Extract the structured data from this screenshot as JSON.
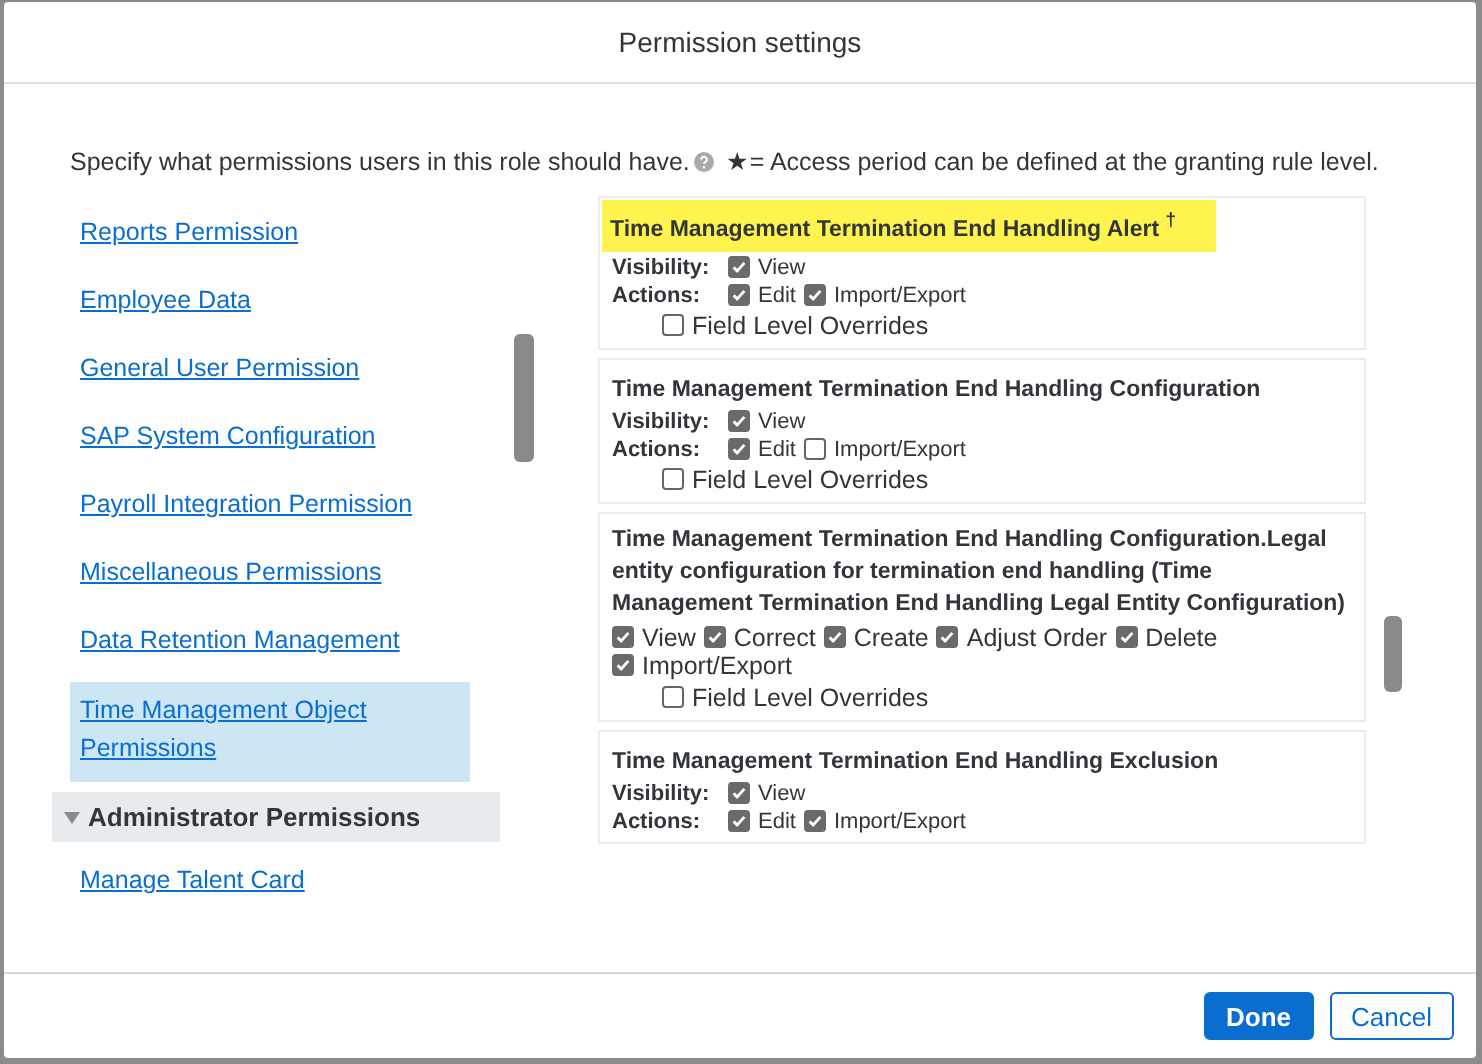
{
  "dialog": {
    "title": "Permission settings"
  },
  "description": {
    "text": "Specify what permissions users in this role should have.",
    "note": "★= Access period can be defined at the granting rule level."
  },
  "nav": [
    {
      "kind": "link",
      "label": "Reports Permission",
      "selected": false
    },
    {
      "kind": "link",
      "label": "Employee Data",
      "selected": false
    },
    {
      "kind": "link",
      "label": "General User Permission",
      "selected": false
    },
    {
      "kind": "link",
      "label": "SAP System Configuration",
      "selected": false
    },
    {
      "kind": "link",
      "label": "Payroll Integration Permission",
      "selected": false
    },
    {
      "kind": "link",
      "label": "Miscellaneous Permissions",
      "selected": false
    },
    {
      "kind": "link",
      "label": "Data Retention Management",
      "selected": false
    },
    {
      "kind": "link",
      "label": "Time Management Object Permissions",
      "selected": true
    },
    {
      "kind": "group",
      "label": "Administrator Permissions",
      "expanded": true
    },
    {
      "kind": "link",
      "label": "Manage Talent Card",
      "selected": false
    }
  ],
  "sections": [
    {
      "title": "Time Management Termination End Handling Alert $^{†}$",
      "highlighted": true,
      "rows": [
        {
          "kind": "labeled",
          "label": "Visibility:",
          "options": [
            {
              "label": "View",
              "checked": true
            }
          ]
        },
        {
          "kind": "labeled",
          "label": "Actions:",
          "options": [
            {
              "label": "Edit",
              "checked": true
            },
            {
              "label": "Import/Export",
              "checked": true
            }
          ]
        },
        {
          "kind": "override",
          "options": [
            {
              "label": "Field Level Overrides",
              "checked": false
            }
          ]
        }
      ]
    },
    {
      "title": "Time Management Termination End Handling Configuration",
      "highlighted": false,
      "rows": [
        {
          "kind": "labeled",
          "label": "Visibility:",
          "options": [
            {
              "label": "View",
              "checked": true
            }
          ]
        },
        {
          "kind": "labeled",
          "label": "Actions:",
          "options": [
            {
              "label": "Edit",
              "checked": true
            },
            {
              "label": "Import/Export",
              "checked": false
            }
          ]
        },
        {
          "kind": "override",
          "options": [
            {
              "label": "Field Level Overrides",
              "checked": false
            }
          ]
        }
      ]
    },
    {
      "title": "Time Management Termination End Handling Configuration.Legal entity configuration for termination end handling (Time Management Termination End Handling Legal Entity Configuration)",
      "highlighted": false,
      "rows": [
        {
          "kind": "flow",
          "options": [
            {
              "label": "View",
              "checked": true
            },
            {
              "label": "Correct",
              "checked": true
            },
            {
              "label": "Create",
              "checked": true
            },
            {
              "label": "Adjust Order",
              "checked": true
            },
            {
              "label": "Delete",
              "checked": true
            },
            {
              "label": "Import/Export",
              "checked": true
            }
          ]
        },
        {
          "kind": "override",
          "options": [
            {
              "label": "Field Level Overrides",
              "checked": false
            }
          ]
        }
      ]
    },
    {
      "title": "Time Management Termination End Handling Exclusion",
      "highlighted": false,
      "rows": [
        {
          "kind": "labeled",
          "label": "Visibility:",
          "options": [
            {
              "label": "View",
              "checked": true
            }
          ]
        },
        {
          "kind": "labeled",
          "label": "Actions:",
          "options": [
            {
              "label": "Edit",
              "checked": true
            },
            {
              "label": "Import/Export",
              "checked": true
            }
          ]
        }
      ]
    }
  ],
  "buttons": [
    {
      "kind": "primary",
      "label": "Done"
    },
    {
      "kind": "secondary",
      "label": "Cancel"
    }
  ]
}
